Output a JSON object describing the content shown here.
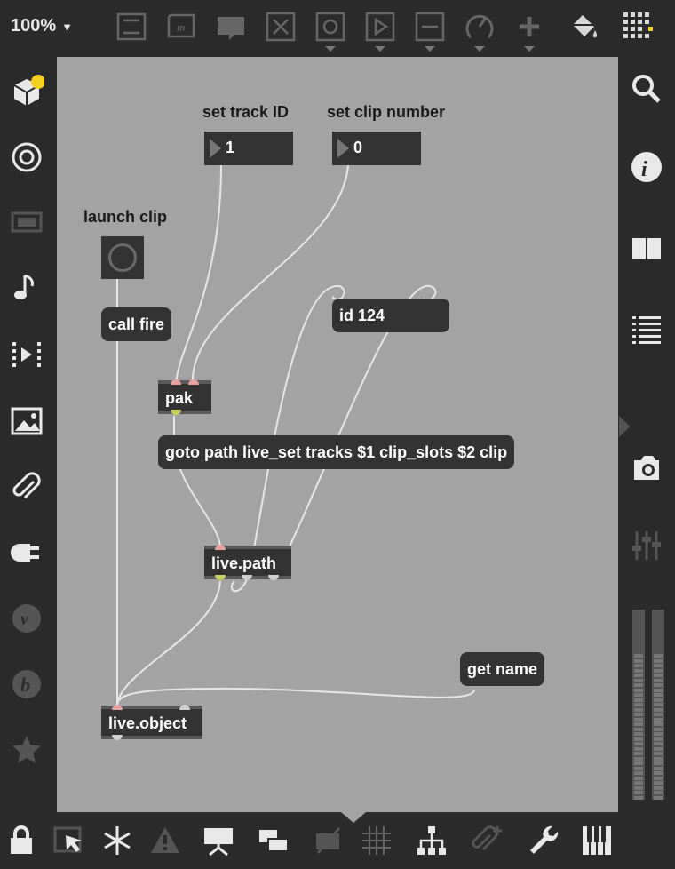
{
  "toolbar": {
    "zoom": "100%",
    "icons": [
      "presentation-icon",
      "message-icon",
      "comment-icon",
      "toggle-x-icon",
      "button-icon",
      "play-icon",
      "slider-icon",
      "dial-icon",
      "plus-icon",
      "paint-bucket-icon",
      "grid-icon"
    ]
  },
  "patch": {
    "label_track": "set track ID",
    "label_clip": "set clip number",
    "label_launch": "launch clip",
    "num_track": "1",
    "num_clip": "0",
    "msg_call_fire": "call fire",
    "msg_id": "id 124",
    "obj_pak": "pak",
    "msg_goto": "goto path live_set tracks $1 clip_slots $2 clip",
    "obj_live_path": "live.path",
    "msg_get_name": "get name",
    "obj_live_object": "live.object"
  },
  "colors": {
    "canvas": "#a3a3a3",
    "chrome": "#2b2b2b",
    "box": "#333333",
    "accent": "#f5d020"
  }
}
